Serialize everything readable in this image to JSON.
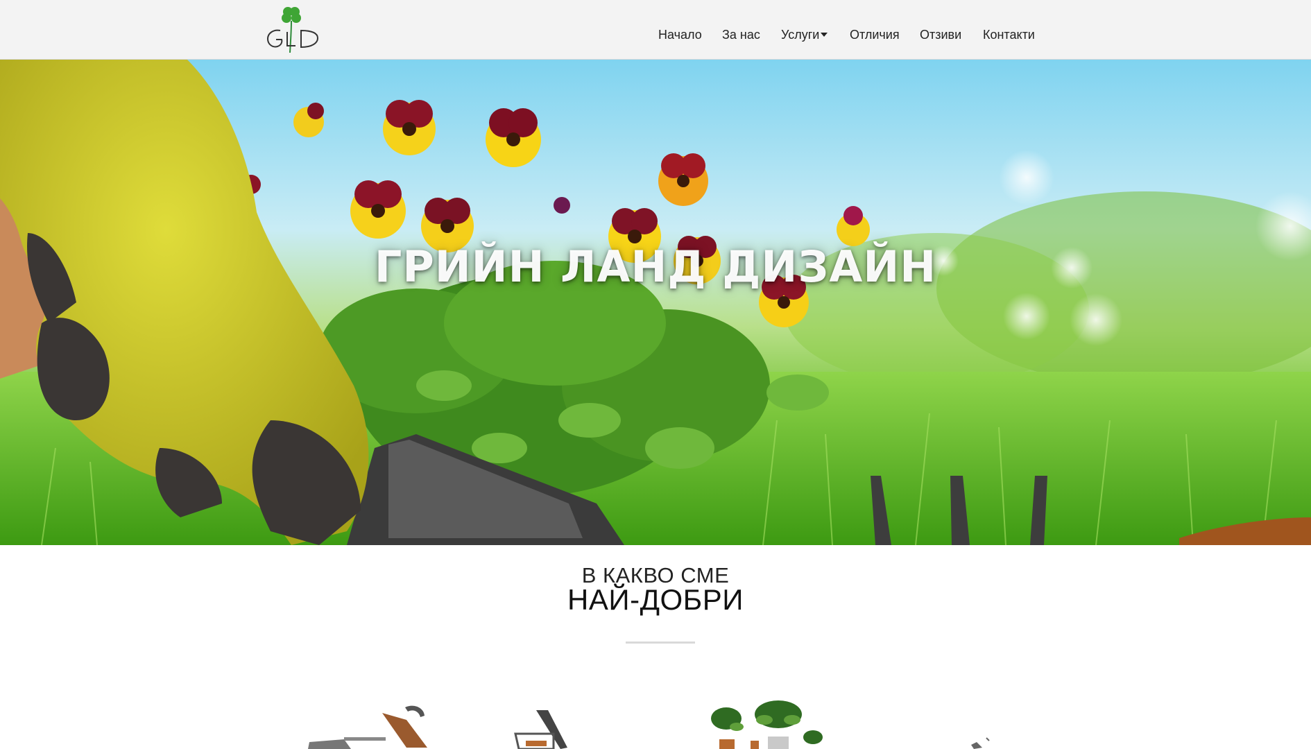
{
  "brand": {
    "logo_icon": "clover-icon",
    "logo_text": "GLD"
  },
  "nav": {
    "items": [
      {
        "label": "Начало"
      },
      {
        "label": "За нас"
      },
      {
        "label": "Услуги",
        "has_dropdown": true
      },
      {
        "label": "Отличия"
      },
      {
        "label": "Отзиви"
      },
      {
        "label": "Контакти"
      }
    ]
  },
  "hero": {
    "title": "ГРИЙН ЛАНД ДИЗАЙН",
    "image_icon": "gardening-hero-image"
  },
  "services_section": {
    "subtitle": "В КАКВО СМЕ",
    "title": "НАЙ-ДОБРИ",
    "icons": [
      "shovel-tools-icon",
      "wheelbarrow-icon",
      "potted-plants-icon",
      "garden-tools-icon"
    ]
  },
  "colors": {
    "navbar_bg": "#f3f3f3",
    "logo_green": "#2e8b3a",
    "text_dark": "#222222",
    "divider": "#d9d9d9"
  }
}
